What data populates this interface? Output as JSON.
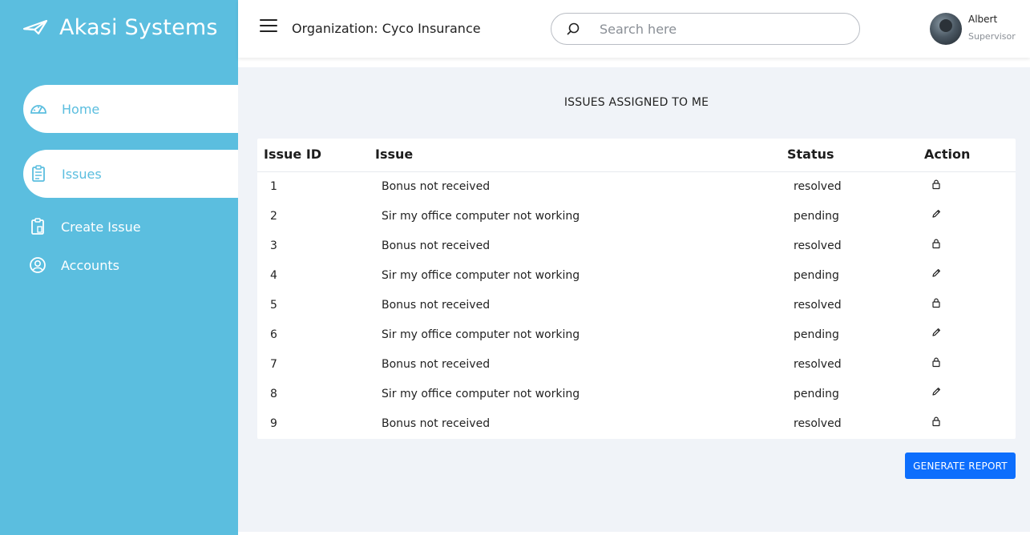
{
  "brand": {
    "title": "Akasi Systems",
    "icon": "paper-plane-logo-icon"
  },
  "sidebar": {
    "items": [
      {
        "label": "Home",
        "icon": "dashboard-gauge-icon",
        "active": true
      },
      {
        "label": "Issues",
        "icon": "clipboard-list-icon",
        "active": true
      },
      {
        "label": "Create Issue",
        "icon": "clipboard-add-icon",
        "active": false
      },
      {
        "label": "Accounts",
        "icon": "user-circle-icon",
        "active": false
      }
    ]
  },
  "header": {
    "organization": "Organization: Cyco Insurance",
    "search_placeholder": "Search here",
    "user": {
      "name": "Albert",
      "role": "Supervisor"
    }
  },
  "main": {
    "section_title": "ISSUES ASSIGNED TO ME",
    "table": {
      "columns": [
        "Issue ID",
        "Issue",
        "Status",
        "Action"
      ],
      "rows": [
        {
          "id": "1",
          "issue": "Bonus not received",
          "status": "resolved",
          "action_icon": "lock-icon"
        },
        {
          "id": "2",
          "issue": "Sir my office computer not working",
          "status": "pending",
          "action_icon": "pencil-icon"
        },
        {
          "id": "3",
          "issue": "Bonus not received",
          "status": "resolved",
          "action_icon": "lock-icon"
        },
        {
          "id": "4",
          "issue": "Sir my office computer not working",
          "status": "pending",
          "action_icon": "pencil-icon"
        },
        {
          "id": "5",
          "issue": "Bonus not received",
          "status": "resolved",
          "action_icon": "lock-icon"
        },
        {
          "id": "6",
          "issue": "Sir my office computer not working",
          "status": "pending",
          "action_icon": "pencil-icon"
        },
        {
          "id": "7",
          "issue": "Bonus not received",
          "status": "resolved",
          "action_icon": "lock-icon"
        },
        {
          "id": "8",
          "issue": "Sir my office computer not working",
          "status": "pending",
          "action_icon": "pencil-icon"
        },
        {
          "id": "9",
          "issue": "Bonus not received",
          "status": "resolved",
          "action_icon": "lock-icon"
        }
      ]
    },
    "report_button_label": "GENERATE REPORT"
  },
  "colors": {
    "sidebar_bg": "#5bbedf",
    "content_bg": "#f0f3f8",
    "primary_button": "#0d6efd"
  }
}
